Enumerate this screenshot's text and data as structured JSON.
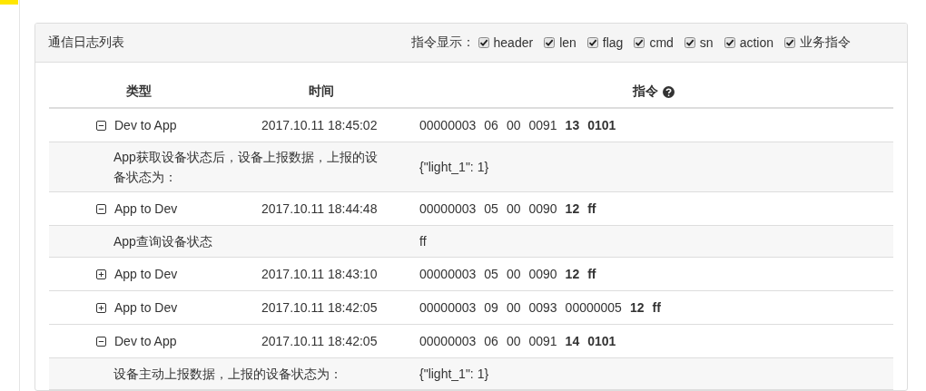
{
  "panel": {
    "title": "通信日志列表",
    "filter_label": "指令显示：",
    "filters": [
      {
        "label": "header",
        "checked": true
      },
      {
        "label": "len",
        "checked": true
      },
      {
        "label": "flag",
        "checked": true
      },
      {
        "label": "cmd",
        "checked": true
      },
      {
        "label": "sn",
        "checked": true
      },
      {
        "label": "action",
        "checked": true
      },
      {
        "label": "业务指令",
        "checked": true
      }
    ]
  },
  "table": {
    "columns": [
      "类型",
      "时间",
      "指令"
    ],
    "rows": [
      {
        "direction": "Dev to App",
        "time": "2017.10.11 18:45:02",
        "expanded": true,
        "command": [
          {
            "text": "00000003",
            "bold": false
          },
          {
            "text": "06",
            "bold": false
          },
          {
            "text": "00",
            "bold": false
          },
          {
            "text": "0091",
            "bold": false
          },
          {
            "text": "13",
            "bold": true
          },
          {
            "text": "0101",
            "bold": true
          }
        ],
        "detail": {
          "description": "App获取设备状态后，设备上报数据，上报的设备状态为：",
          "payload": "{\"light_1\": 1}"
        }
      },
      {
        "direction": "App to Dev",
        "time": "2017.10.11 18:44:48",
        "expanded": true,
        "command": [
          {
            "text": "00000003",
            "bold": false
          },
          {
            "text": "05",
            "bold": false
          },
          {
            "text": "00",
            "bold": false
          },
          {
            "text": "0090",
            "bold": false
          },
          {
            "text": "12",
            "bold": true
          },
          {
            "text": "ff",
            "bold": true
          }
        ],
        "detail": {
          "description": "App查询设备状态",
          "payload": "ff"
        }
      },
      {
        "direction": "App to Dev",
        "time": "2017.10.11 18:43:10",
        "expanded": false,
        "command": [
          {
            "text": "00000003",
            "bold": false
          },
          {
            "text": "05",
            "bold": false
          },
          {
            "text": "00",
            "bold": false
          },
          {
            "text": "0090",
            "bold": false
          },
          {
            "text": "12",
            "bold": true
          },
          {
            "text": "ff",
            "bold": true
          }
        ]
      },
      {
        "direction": "App to Dev",
        "time": "2017.10.11 18:42:05",
        "expanded": false,
        "command": [
          {
            "text": "00000003",
            "bold": false
          },
          {
            "text": "09",
            "bold": false
          },
          {
            "text": "00",
            "bold": false
          },
          {
            "text": "0093",
            "bold": false
          },
          {
            "text": "00000005",
            "bold": false
          },
          {
            "text": "12",
            "bold": true
          },
          {
            "text": "ff",
            "bold": true
          }
        ]
      },
      {
        "direction": "Dev to App",
        "time": "2017.10.11 18:42:05",
        "expanded": true,
        "command": [
          {
            "text": "00000003",
            "bold": false
          },
          {
            "text": "06",
            "bold": false
          },
          {
            "text": "00",
            "bold": false
          },
          {
            "text": "0091",
            "bold": false
          },
          {
            "text": "14",
            "bold": true
          },
          {
            "text": "0101",
            "bold": true
          }
        ],
        "detail": {
          "description": "设备主动上报数据，上报的设备状态为：",
          "payload": "{\"light_1\": 1}"
        }
      }
    ]
  }
}
